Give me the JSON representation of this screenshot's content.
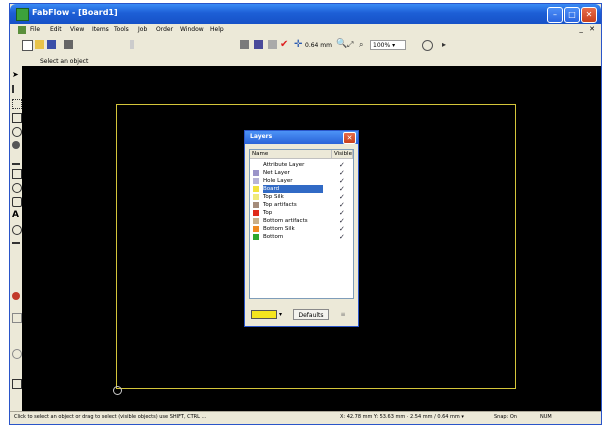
{
  "window": {
    "title": "FabFlow - [Board1]",
    "min": "–",
    "max": "□",
    "close": "✕"
  },
  "menu": {
    "items": [
      "File",
      "Edit",
      "View",
      "Items",
      "Tools",
      "Job",
      "Order",
      "Window",
      "Help"
    ],
    "mdi_controls": "_ ✕"
  },
  "toolbar": {
    "grid": "0.64 mm",
    "zoom": "100%",
    "zoom_caret": "▾"
  },
  "hint": "Select an object",
  "layers_dialog": {
    "title": "Layers",
    "col_name": "Name",
    "col_visible": "Visible",
    "rows": [
      {
        "name": "Attribute Layer",
        "color": "#ffffff",
        "visible": "✓"
      },
      {
        "name": "Net Layer",
        "color": "#9b94c9",
        "visible": "✓"
      },
      {
        "name": "Hole Layer",
        "color": "#b7b4d6",
        "visible": "✓"
      },
      {
        "name": "Board",
        "color": "#f2e23a",
        "visible": "✓",
        "selected": true
      },
      {
        "name": "Top Silk",
        "color": "#f0ea7a",
        "visible": "✓"
      },
      {
        "name": "Top artifacts",
        "color": "#a58c7a",
        "visible": "✓"
      },
      {
        "name": "Top",
        "color": "#e02a1a",
        "visible": "✓"
      },
      {
        "name": "Bottom artifacts",
        "color": "#c9b08a",
        "visible": "✓"
      },
      {
        "name": "Bottom Silk",
        "color": "#f08a20",
        "visible": "✓"
      },
      {
        "name": "Bottom",
        "color": "#2ea82e",
        "visible": "✓"
      }
    ],
    "current_color": "#f5e61e",
    "color_caret": "▾",
    "defaults_button": "Defaults",
    "reset_button": "≡"
  },
  "statusbar": {
    "hint": "Click to select an object or drag to select (visible objects) use SHIFT, CTRL ...",
    "coords": "X: 42.78 mm Y: 53.63 mm · 2.54 mm / 0.64 mm ▾",
    "snap": "Snap: On",
    "mode": "NUM"
  },
  "colors": {
    "canvas": "#000000",
    "board_outline": "#d4c53a",
    "title_blue": "#1d5fd6"
  }
}
